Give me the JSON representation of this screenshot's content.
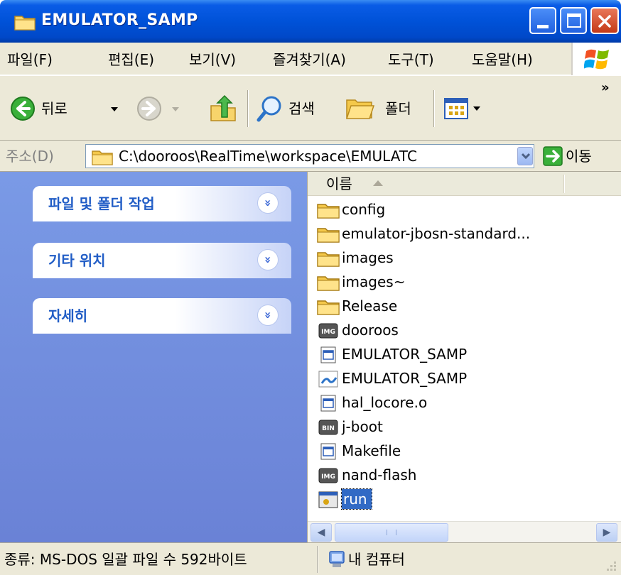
{
  "window": {
    "title": "EMULATOR_SAMP"
  },
  "menu": {
    "items": [
      {
        "label": "파일(F)"
      },
      {
        "label": "편집(E)"
      },
      {
        "label": "보기(V)"
      },
      {
        "label": "즐겨찾기(A)"
      },
      {
        "label": "도구(T)"
      },
      {
        "label": "도움말(H)"
      }
    ]
  },
  "toolbar": {
    "back_label": "뒤로",
    "search_label": "검색",
    "folders_label": "폴더",
    "overflow": "»"
  },
  "address": {
    "label": "주소(D)",
    "path": "C:\\dooroos\\RealTime\\workspace\\EMULATC",
    "go_label": "이동"
  },
  "taskpane": {
    "sections": [
      {
        "title": "파일 및 폴더 작업"
      },
      {
        "title": "기타 위치"
      },
      {
        "title": "자세히"
      }
    ],
    "chevron": "»"
  },
  "filelist": {
    "column_name": "이름",
    "files": [
      {
        "name": "config",
        "icon": "folder-icon"
      },
      {
        "name": "emulator-jbosn-standard...",
        "icon": "folder-icon"
      },
      {
        "name": "images",
        "icon": "folder-icon"
      },
      {
        "name": "images~",
        "icon": "folder-icon"
      },
      {
        "name": "Release",
        "icon": "folder-icon"
      },
      {
        "name": "dooroos",
        "icon": "img-file-icon"
      },
      {
        "name": "EMULATOR_SAMP",
        "icon": "app-file-icon"
      },
      {
        "name": "EMULATOR_SAMP",
        "icon": "workspace-file-icon"
      },
      {
        "name": "hal_locore.o",
        "icon": "app-file-icon"
      },
      {
        "name": "j-boot",
        "icon": "bin-file-icon"
      },
      {
        "name": "Makefile",
        "icon": "app-file-icon"
      },
      {
        "name": "nand-flash",
        "icon": "img-file-icon"
      },
      {
        "name": "run",
        "icon": "batch-file-icon",
        "selected": true
      }
    ]
  },
  "statusbar": {
    "left": "종류: MS-DOS 일괄 파일 수 592바이트",
    "right": "내 컴퓨터"
  },
  "colors": {
    "titlebar": "#0052d8",
    "taskpane": "#7a9ae6",
    "selection": "#316ac5",
    "chrome": "#ece9d8"
  }
}
